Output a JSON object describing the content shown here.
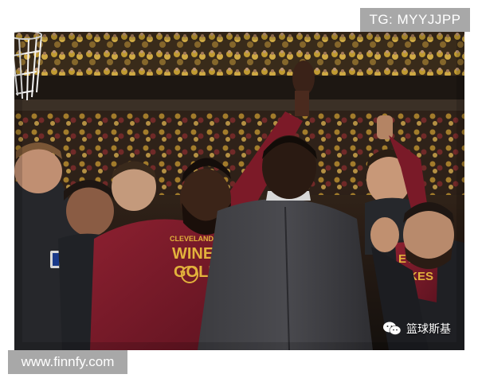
{
  "watermarks": {
    "top_right": "TG: MYYJJPP",
    "bottom_left": "www.finnfy.com",
    "wechat_account": "篮球斯基"
  },
  "shirt_print": {
    "line1": "CLEVELAND",
    "line2": "WINE",
    "line3": "GOLD",
    "right_shirt": "EVER\nFKES"
  },
  "icons": [
    "basketball-hoop-net",
    "wechat-icon",
    "nba-logo-patch"
  ],
  "colors": {
    "wine": "#7a1a27",
    "gold": "#e2b23c",
    "suit": "#3a3a3e",
    "crowd_gold": "#c9a133"
  }
}
